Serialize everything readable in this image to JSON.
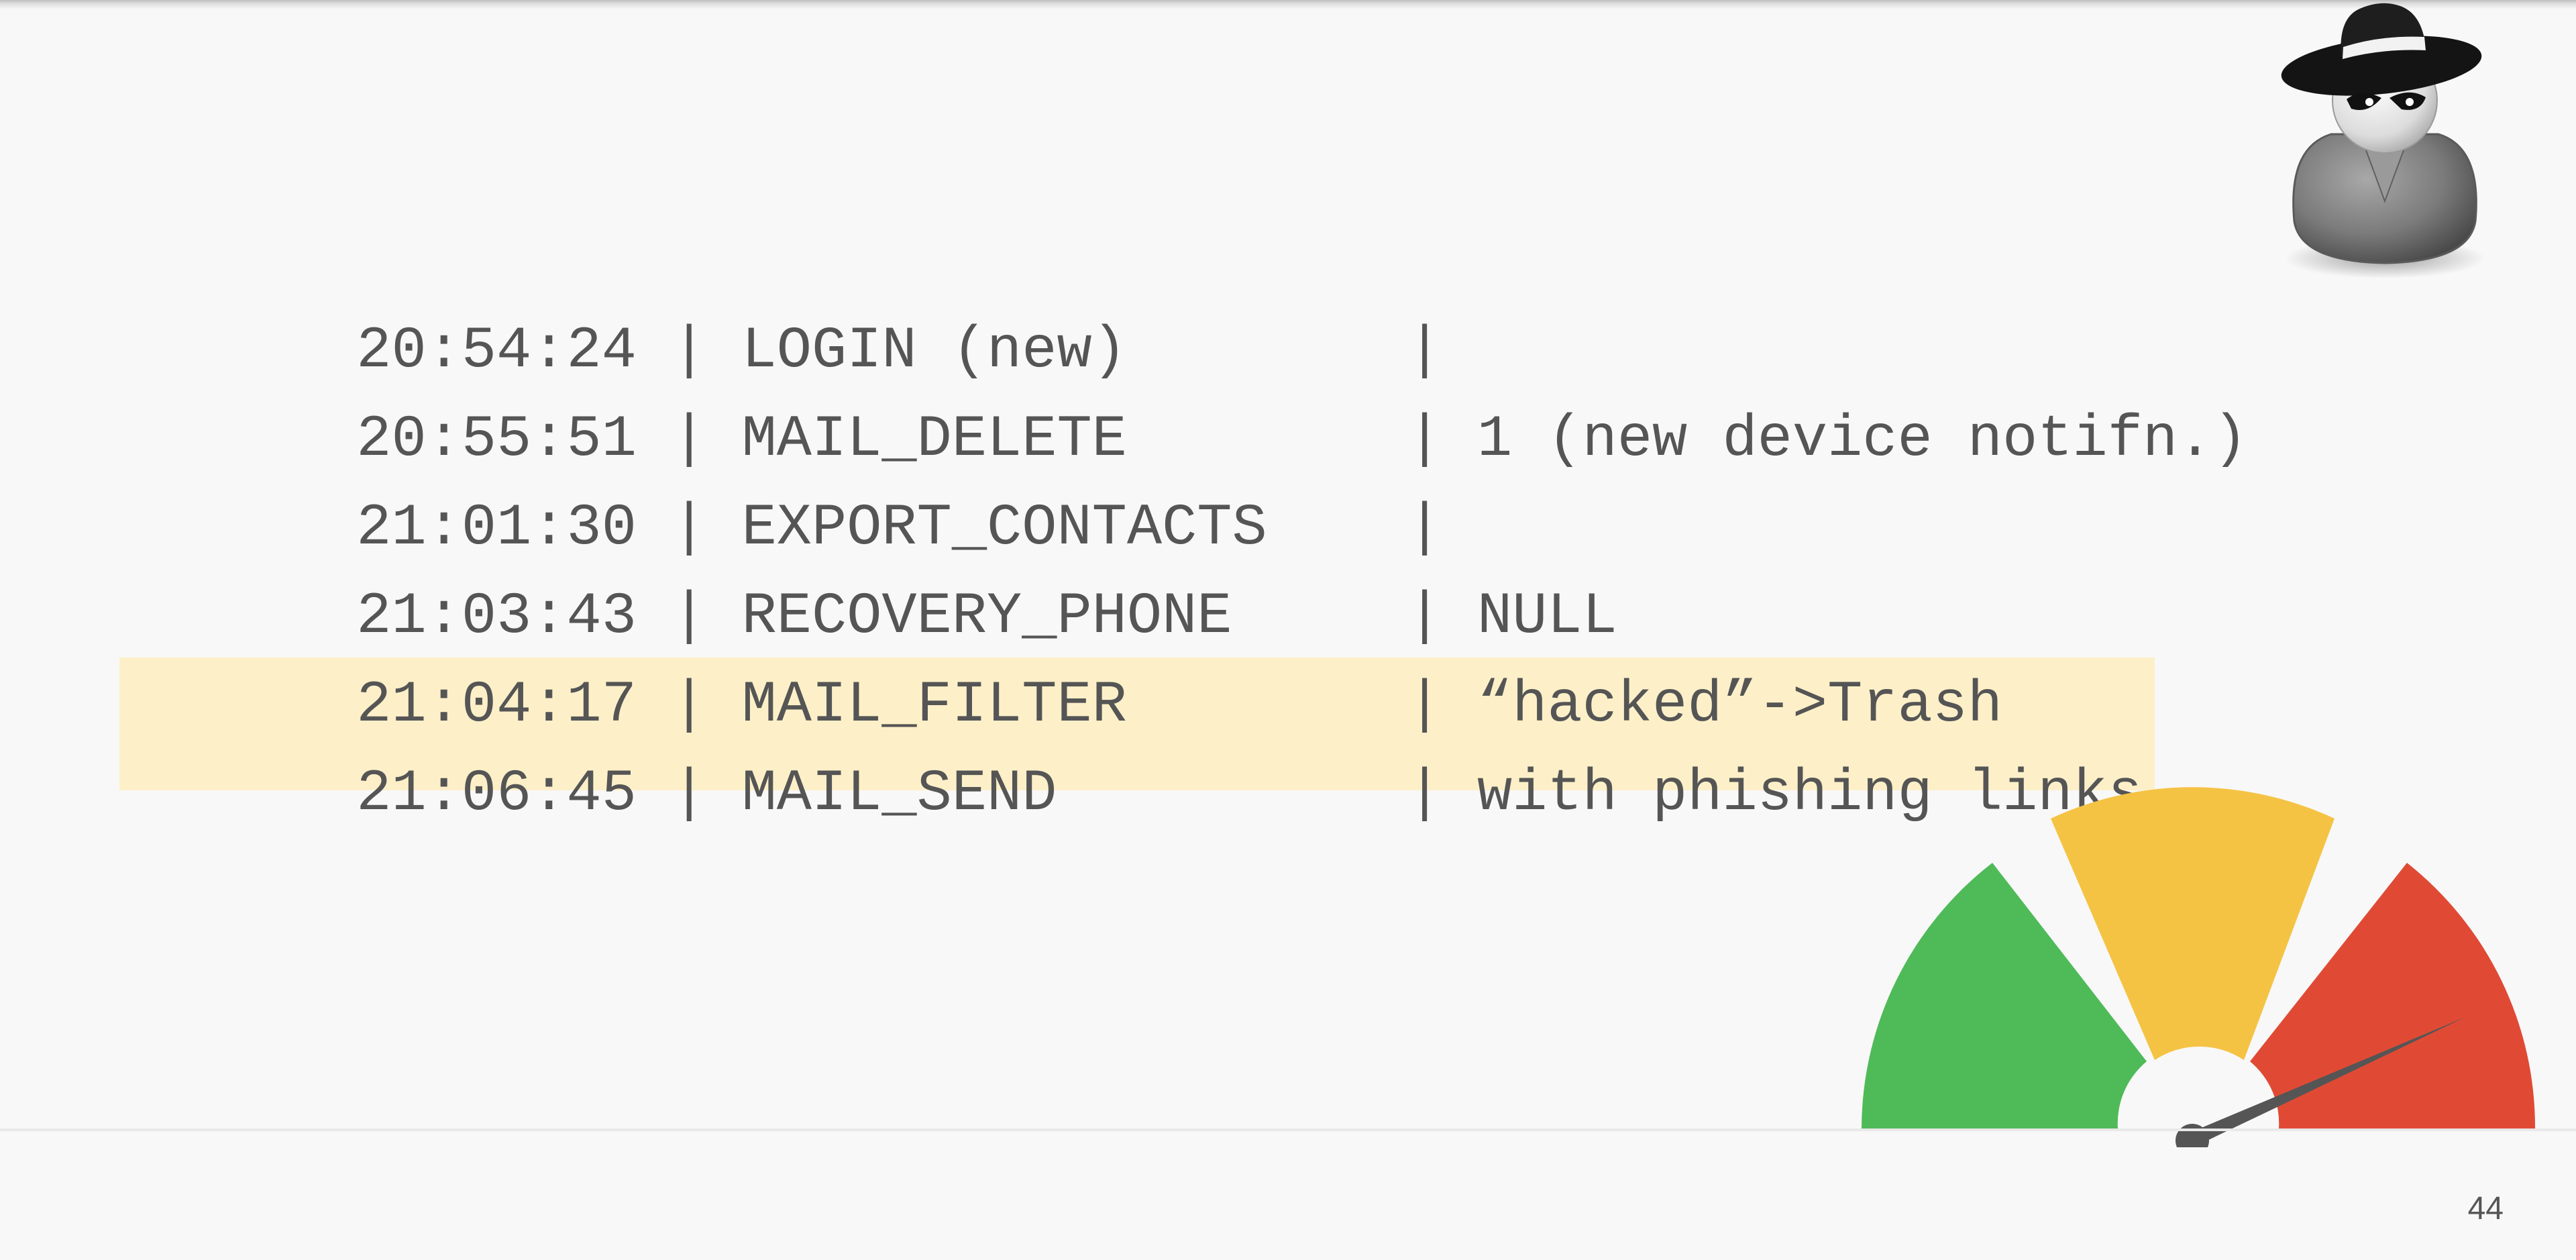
{
  "log": {
    "rows": [
      {
        "time": "20:54:24",
        "sep1": " | ",
        "event": "LOGIN (new)       ",
        "sep2": " | ",
        "detail": ""
      },
      {
        "time": "20:55:51",
        "sep1": " | ",
        "event": "MAIL_DELETE       ",
        "sep2": " | ",
        "detail": "1 (new device notifn.)"
      },
      {
        "time": "21:01:30",
        "sep1": " | ",
        "event": "EXPORT_CONTACTS   ",
        "sep2": " | ",
        "detail": ""
      },
      {
        "time": "21:03:43",
        "sep1": " | ",
        "event": "RECOVERY_PHONE    ",
        "sep2": " | ",
        "detail": "NULL"
      },
      {
        "time": "21:04:17",
        "sep1": " | ",
        "event": "MAIL_FILTER       ",
        "sep2": " | ",
        "detail": "“hacked”->Trash"
      },
      {
        "time": "21:06:45",
        "sep1": " | ",
        "event": "MAIL_SEND         ",
        "sep2": " | ",
        "detail": "with phishing links"
      }
    ],
    "highlighted_row": 6
  },
  "colors": {
    "text": "#555555",
    "highlight": "#fdf0c8",
    "gauge_green": "#4fba58",
    "gauge_yellow": "#f5c344",
    "gauge_red": "#e04a35",
    "needle": "#555555"
  },
  "icons": {
    "spy": "spy-icon",
    "gauge": "risk-gauge-icon"
  },
  "footer": {
    "page_number": "44"
  }
}
